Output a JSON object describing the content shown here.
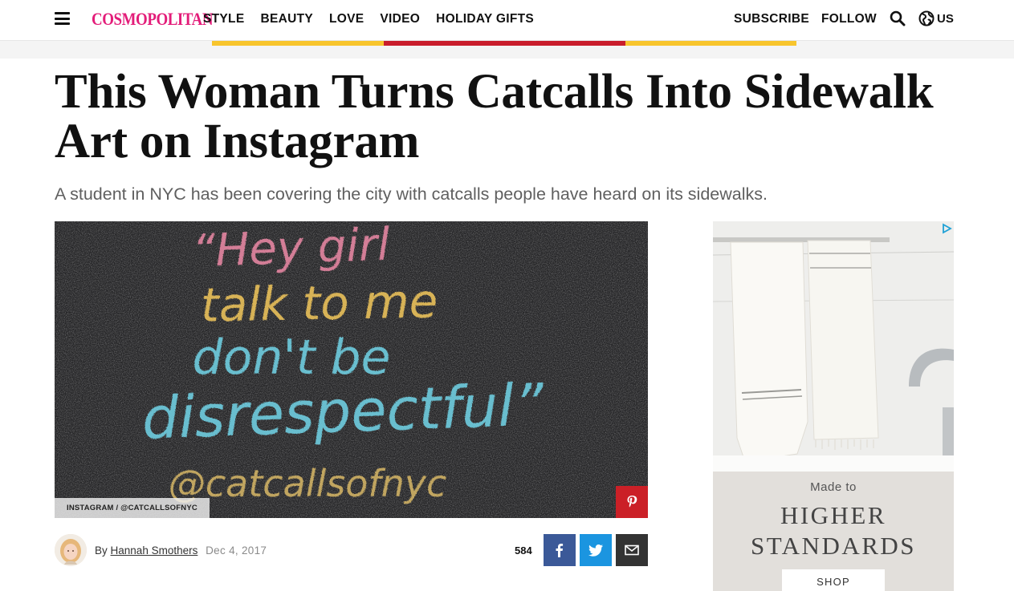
{
  "header": {
    "logo": "COSMOPOLITAN",
    "nav": [
      "STYLE",
      "BEAUTY",
      "LOVE",
      "VIDEO",
      "HOLIDAY GIFTS"
    ],
    "subscribe": "SUBSCRIBE",
    "follow": "FOLLOW",
    "edition": "US",
    "icons": [
      "hamburger-menu-icon",
      "search-icon",
      "globe-icon"
    ]
  },
  "article": {
    "headline": "This Woman Turns Catcalls Into Sidewalk Art on Instagram",
    "dek": "A student in NYC has been covering the city with catcalls people have heard on its sidewalks.",
    "image": {
      "chalk_lines": [
        "“Hey girl",
        "talk to me",
        "don't be",
        "disrespectful”",
        "@catcallsofnyc"
      ],
      "credit": "INSTAGRAM / @CATCALLSOFNYC"
    },
    "byline": {
      "prefix": "By",
      "author": "Hannah Smothers",
      "date": "Dec 4, 2017"
    },
    "share_count": "584"
  },
  "side_ad": {
    "made_to": "Made to",
    "headline_1": "HIGHER",
    "headline_2": "STANDARDS",
    "cta": "SHOP"
  },
  "colors": {
    "brand": "#e31c79",
    "pinterest": "#cb2027",
    "facebook": "#3b5998",
    "twitter": "#1b95e0",
    "email": "#333333"
  }
}
